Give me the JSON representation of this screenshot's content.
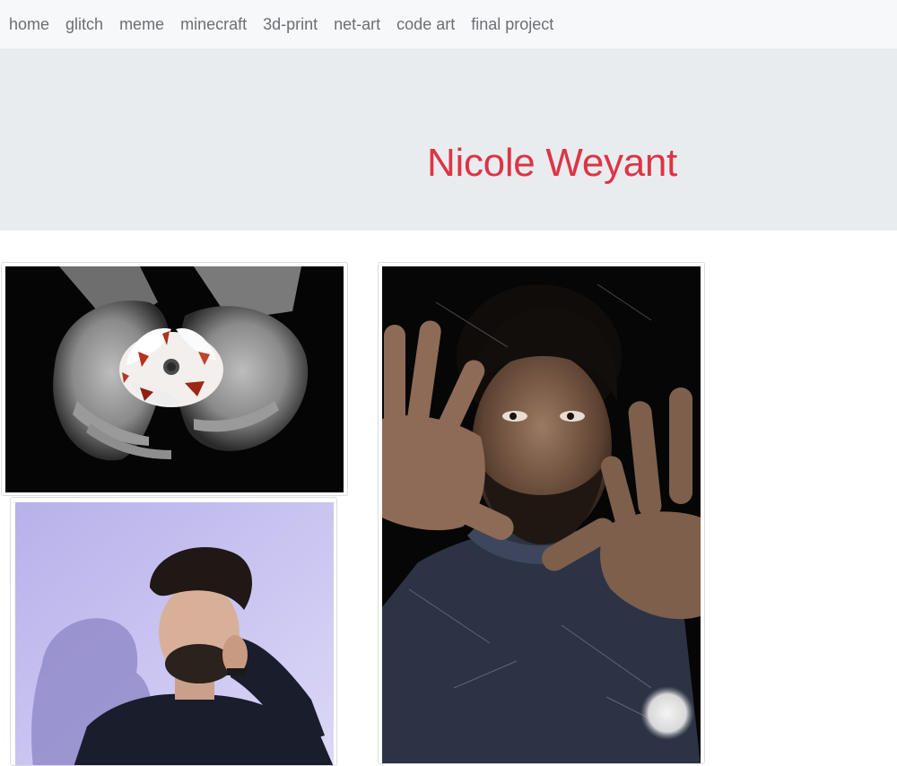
{
  "nav": {
    "links": [
      "home",
      "glitch",
      "meme",
      "minecraft",
      "3d-print",
      "net-art",
      "code art",
      "final project"
    ]
  },
  "header": {
    "title": "Nicole Weyant"
  },
  "colors": {
    "title": "#dc3545",
    "navbar_bg": "#f7f8fa",
    "jumbotron_bg": "#e9ecef",
    "nav_text": "#6b6f74"
  },
  "gallery": {
    "photos": [
      "hands-holding-flower-photo",
      "man-behind-glass-photo",
      "man-portrait-lavender-photo"
    ]
  }
}
